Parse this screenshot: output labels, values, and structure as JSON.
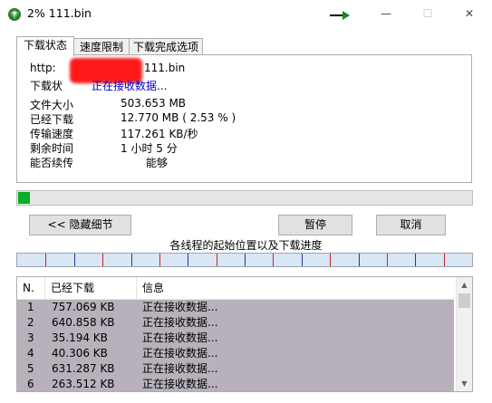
{
  "window": {
    "title": "2% 111.bin",
    "minimize_glyph": "—",
    "maximize_glyph": "☐",
    "close_glyph": "✕"
  },
  "tabs": [
    {
      "label": "下载状态"
    },
    {
      "label": "速度限制"
    },
    {
      "label": "下载完成选项"
    }
  ],
  "status": {
    "url_prefix": "http:",
    "url_suffix": "111.bin",
    "state_label": "下载状",
    "state_value": "正在接收数据...",
    "file_size_label": "文件大小",
    "file_size_value": "503.653  MB",
    "downloaded_label": "已经下载",
    "downloaded_value": "12.770  MB  ( 2.53 % )",
    "speed_label": "传输速度",
    "speed_value": "117.261  KB/秒",
    "remaining_label": "剩余时间",
    "remaining_value": "1 小时 5 分",
    "resume_label": "能否续传",
    "resume_value": "能够"
  },
  "progress": {
    "percent": 2.53
  },
  "buttons": {
    "hide_details": "<< 隐藏细节",
    "pause": "暂停",
    "cancel": "取消"
  },
  "threads_label": "各线程的起始位置以及下载进度",
  "thread_list": {
    "headers": {
      "n": "N.",
      "downloaded": "已经下载",
      "info": "信息"
    },
    "rows": [
      {
        "n": "1",
        "downloaded": "757.069  KB",
        "info": "正在接收数据..."
      },
      {
        "n": "2",
        "downloaded": "640.858  KB",
        "info": "正在接收数据..."
      },
      {
        "n": "3",
        "downloaded": "35.194  KB",
        "info": "正在接收数据..."
      },
      {
        "n": "4",
        "downloaded": "40.306  KB",
        "info": "正在接收数据..."
      },
      {
        "n": "5",
        "downloaded": "631.287  KB",
        "info": "正在接收数据..."
      },
      {
        "n": "6",
        "downloaded": "263.512  KB",
        "info": "正在接收数据..."
      }
    ]
  },
  "colors": {
    "progress_green": "#06b025",
    "row_background": "#b8b1bb",
    "redaction": "#ff1a1a"
  }
}
